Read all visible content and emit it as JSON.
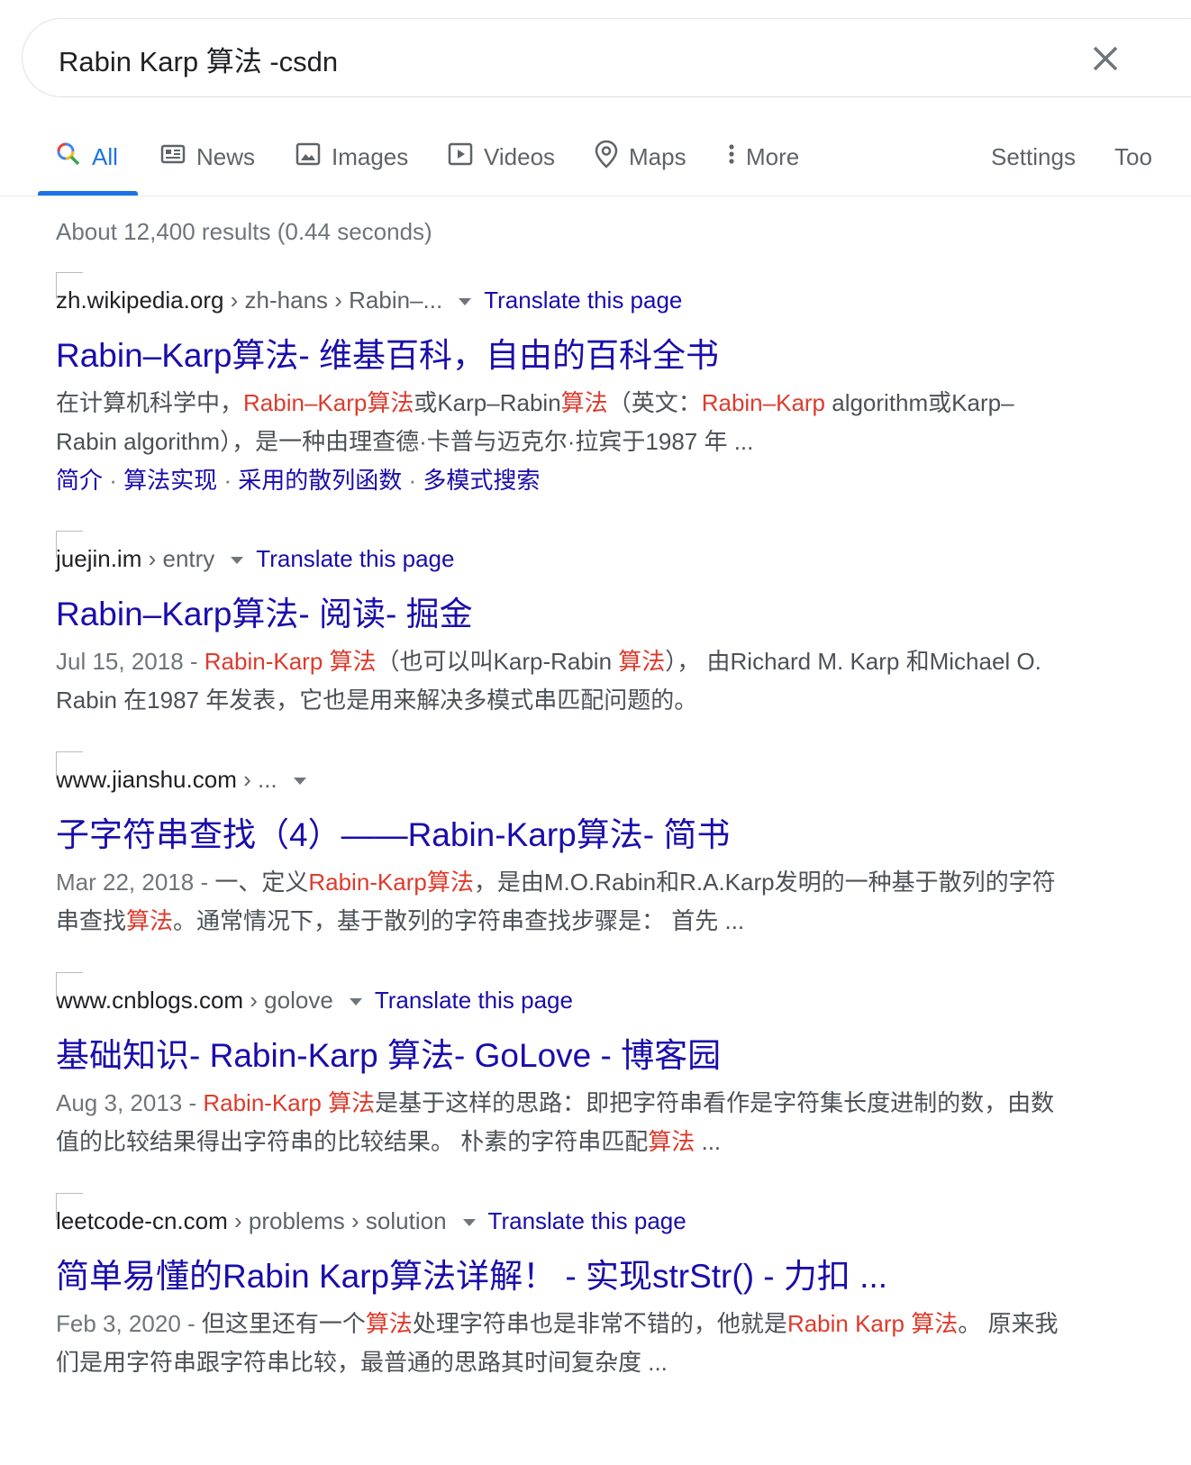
{
  "search": {
    "query": "Rabin Karp 算法 -csdn"
  },
  "tabs": [
    {
      "label": "All",
      "icon": "search-icon",
      "active": true
    },
    {
      "label": "News",
      "icon": "news-icon"
    },
    {
      "label": "Images",
      "icon": "image-icon"
    },
    {
      "label": "Videos",
      "icon": "video-icon"
    },
    {
      "label": "Maps",
      "icon": "map-pin-icon"
    },
    {
      "label": "More",
      "icon": "more-vert-icon"
    },
    {
      "label": "Settings"
    },
    {
      "label": "Too"
    }
  ],
  "stats": "About 12,400 results (0.44 seconds)",
  "colors": {
    "link": "#1a0dab",
    "highlight": "#dd3b2c",
    "accent": "#1a73e8"
  },
  "results": [
    {
      "domain": "zh.wikipedia.org",
      "path": " › zh-hans › Rabin–...",
      "translate": "Translate this page",
      "title": "Rabin–Karp算法- 维基百科，自由的百科全书",
      "snippet_line1": [
        {
          "t": "在计算机科学中，",
          "h": false
        },
        {
          "t": "Rabin–Karp算法",
          "h": true
        },
        {
          "t": "或Karp–Rabin",
          "h": false
        },
        {
          "t": "算法",
          "h": true
        },
        {
          "t": "（英文：",
          "h": false
        },
        {
          "t": "Rabin–Karp",
          "h": true
        },
        {
          "t": " algorithm或Karp–",
          "h": false
        }
      ],
      "snippet_line2": [
        {
          "t": "Rabin algorithm），是一种由理查德·卡普与迈克尔·拉宾于1987 年 ...",
          "h": false
        }
      ],
      "sitelinks": [
        "简介",
        "算法实现",
        "采用的散列函数",
        "多模式搜索"
      ]
    },
    {
      "domain": "juejin.im",
      "path": " › entry",
      "translate": "Translate this page",
      "title": "Rabin–Karp算法- 阅读- 掘金",
      "date": "Jul 15, 2018",
      "snippet_line1": [
        {
          "t": "Rabin-Karp 算法",
          "h": true
        },
        {
          "t": "（也可以叫Karp-Rabin ",
          "h": false
        },
        {
          "t": "算法",
          "h": true
        },
        {
          "t": "）， 由Richard M. Karp 和Michael O.",
          "h": false
        }
      ],
      "snippet_line2": [
        {
          "t": "Rabin 在1987 年发表，它也是用来解决多模式串匹配问题的。",
          "h": false
        }
      ]
    },
    {
      "domain": "www.jianshu.com",
      "path": " › ...",
      "translate": "",
      "title": "子字符串查找（4）——Rabin-Karp算法- 简书",
      "date": "Mar 22, 2018",
      "snippet_line1": [
        {
          "t": "一、定义",
          "h": false
        },
        {
          "t": "Rabin-Karp算法",
          "h": true
        },
        {
          "t": "，是由M.O.Rabin和R.A.Karp发明的一种基于散列的字符",
          "h": false
        }
      ],
      "snippet_line2": [
        {
          "t": "串查找",
          "h": false
        },
        {
          "t": "算法",
          "h": true
        },
        {
          "t": "。通常情况下，基于散列的字符串查找步骤是： 首先 ...",
          "h": false
        }
      ]
    },
    {
      "domain": "www.cnblogs.com",
      "path": " › golove",
      "translate": "Translate this page",
      "title": "基础知识- Rabin-Karp 算法- GoLove - 博客园",
      "date": "Aug 3, 2013",
      "snippet_line1": [
        {
          "t": "Rabin-Karp 算法",
          "h": true
        },
        {
          "t": "是基于这样的思路：即把字符串看作是字符集长度进制的数，由数",
          "h": false
        }
      ],
      "snippet_line2": [
        {
          "t": "值的比较结果得出字符串的比较结果。 朴素的字符串匹配",
          "h": false
        },
        {
          "t": "算法",
          "h": true
        },
        {
          "t": " ...",
          "h": false
        }
      ]
    },
    {
      "domain": "leetcode-cn.com",
      "path": " › problems › solution",
      "translate": "Translate this page",
      "title": "简单易懂的Rabin Karp算法详解！ - 实现strStr() - 力扣 ...",
      "date": "Feb 3, 2020",
      "snippet_line1": [
        {
          "t": "但这里还有一个",
          "h": false
        },
        {
          "t": "算法",
          "h": true
        },
        {
          "t": "处理字符串也是非常不错的，他就是",
          "h": false
        },
        {
          "t": "Rabin Karp 算法",
          "h": true
        },
        {
          "t": "。 原来我",
          "h": false
        }
      ],
      "snippet_line2": [
        {
          "t": "们是用字符串跟字符串比较，最普通的思路其时间复杂度 ...",
          "h": false
        }
      ]
    }
  ]
}
